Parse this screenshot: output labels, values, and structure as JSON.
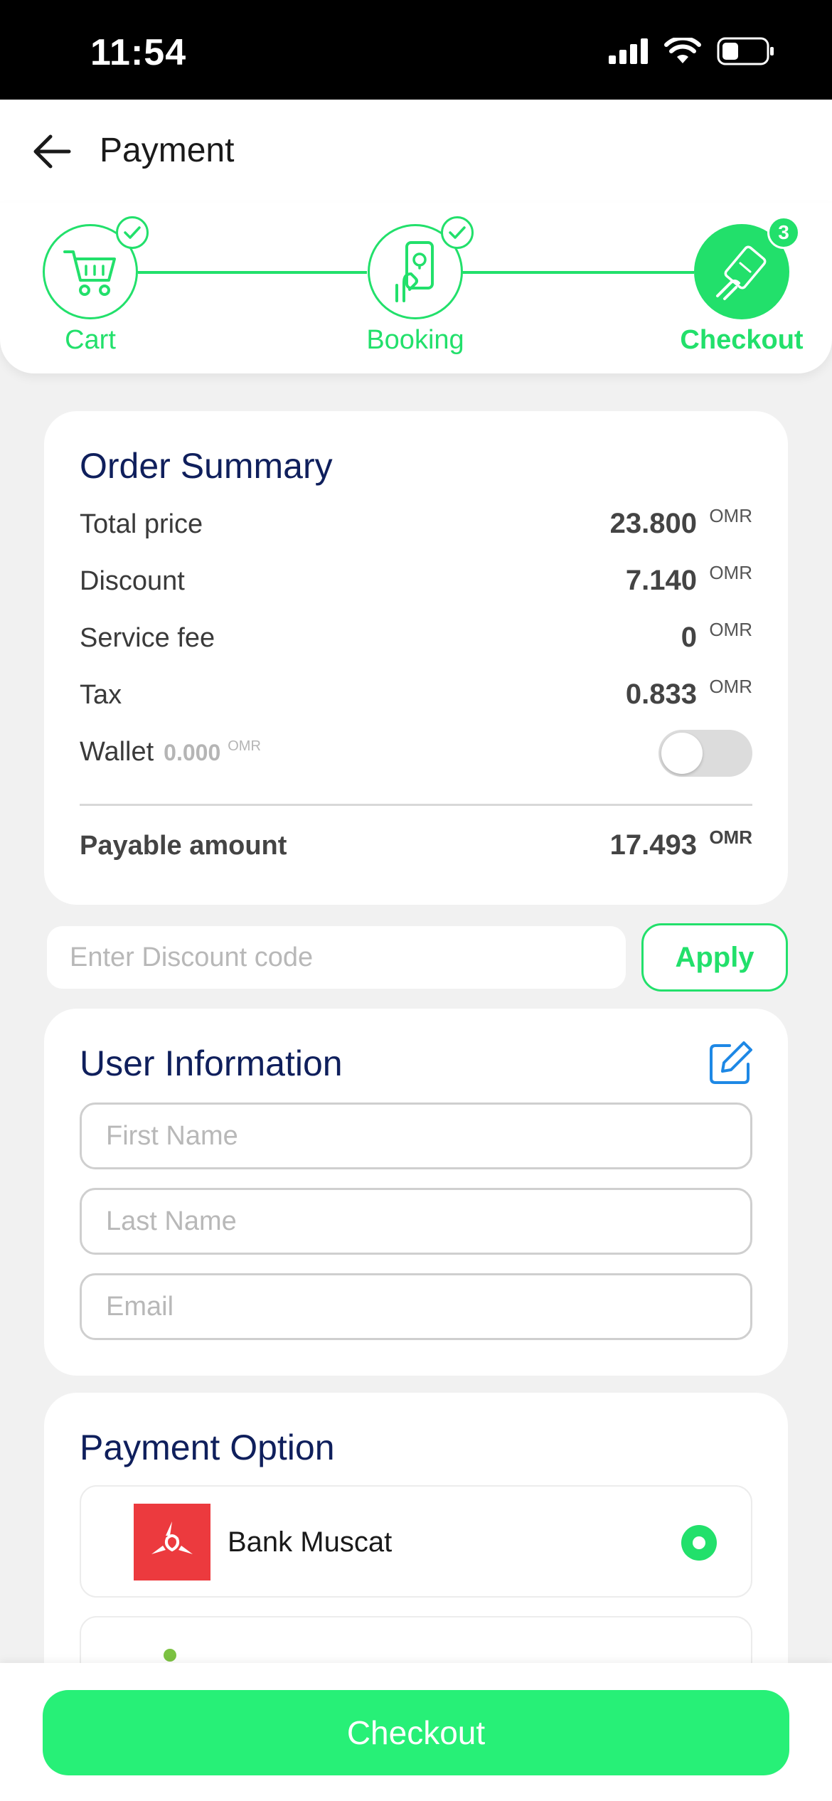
{
  "status_bar": {
    "time": "11:54"
  },
  "header": {
    "title": "Payment"
  },
  "stepper": {
    "steps": [
      {
        "label": "Cart",
        "completed": true
      },
      {
        "label": "Booking",
        "completed": true
      },
      {
        "label": "Checkout",
        "active": true,
        "badge": "3"
      }
    ]
  },
  "order_summary": {
    "title": "Order Summary",
    "rows": [
      {
        "label": "Total price",
        "value": "23.800",
        "unit": "OMR"
      },
      {
        "label": "Discount",
        "value": "7.140",
        "unit": "OMR"
      },
      {
        "label": "Service fee",
        "value": "0",
        "unit": "OMR"
      },
      {
        "label": "Tax",
        "value": "0.833",
        "unit": "OMR"
      }
    ],
    "wallet": {
      "label": "Wallet",
      "amount": "0.000",
      "unit": "OMR",
      "enabled": false
    },
    "payable": {
      "label": "Payable amount",
      "value": "17.493",
      "unit": "OMR"
    }
  },
  "discount": {
    "placeholder": "Enter Discount code",
    "apply_label": "Apply"
  },
  "user_info": {
    "title": "User Information",
    "first_name_placeholder": "First Name",
    "last_name_placeholder": "Last Name",
    "email_placeholder": "Email"
  },
  "payment_option": {
    "title": "Payment Option",
    "options": [
      {
        "name": "Bank Muscat",
        "selected": true
      }
    ]
  },
  "footer": {
    "checkout_label": "Checkout"
  },
  "colors": {
    "accent": "#22e06b",
    "title": "#0f1f5c",
    "bank_red": "#ec3a3e"
  }
}
